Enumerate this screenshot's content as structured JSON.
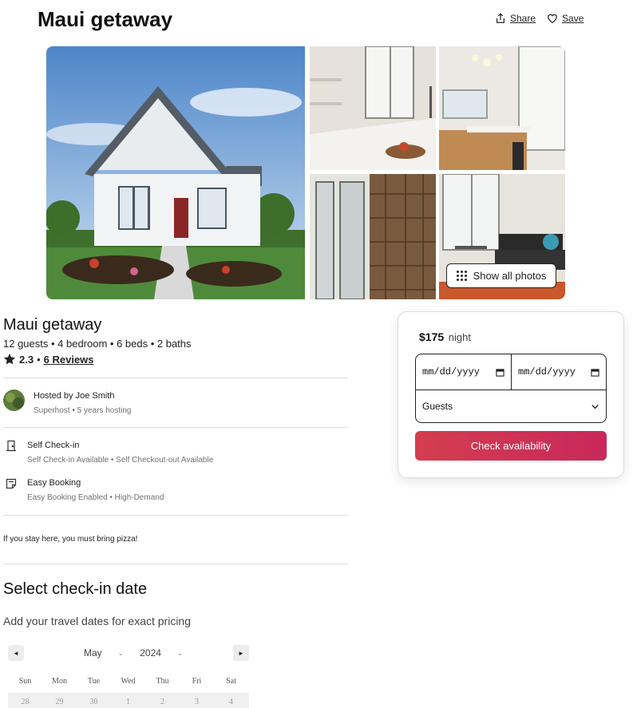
{
  "header": {
    "title": "Maui getaway",
    "share_label": "Share",
    "save_label": "Save"
  },
  "gallery": {
    "show_all_label": "Show all photos"
  },
  "listing": {
    "name": "Maui getaway",
    "specs": "12 guests • 4 bedroom • 6 beds • 2 baths",
    "rating": "2.3",
    "separator": "•",
    "reviews_label": "6 Reviews"
  },
  "host": {
    "name": "Hosted by Joe Smith",
    "subtitle": "Superhost • 5 years hosting"
  },
  "features": [
    {
      "title": "Self Check-in",
      "subtitle": "Self Check-in Available • Self Checkout-out Available",
      "icon": "door-icon"
    },
    {
      "title": "Easy Booking",
      "subtitle": "Easy Booking Enabled • High-Demand",
      "icon": "note-icon"
    }
  ],
  "description": "If you stay here, you must bring pizza!",
  "checkin_section": {
    "title": "Select check-in date",
    "subtitle": "Add your travel dates for exact pricing"
  },
  "calendar": {
    "prev": "◄",
    "next": "►",
    "month": "May",
    "year": "2024",
    "weekdays": [
      "Sun",
      "Mon",
      "Tue",
      "Wed",
      "Thu",
      "Fri",
      "Sat"
    ],
    "first_row": [
      "28",
      "29",
      "30",
      "1",
      "2",
      "3",
      "4"
    ]
  },
  "booking": {
    "price": "$175",
    "unit": "night",
    "checkin_value": "mm/dd/yyyy",
    "checkout_value": "mm/dd/yyyy",
    "guests_value": "Guests",
    "button_label": "Check availability",
    "button_color": "#d43d4f"
  }
}
